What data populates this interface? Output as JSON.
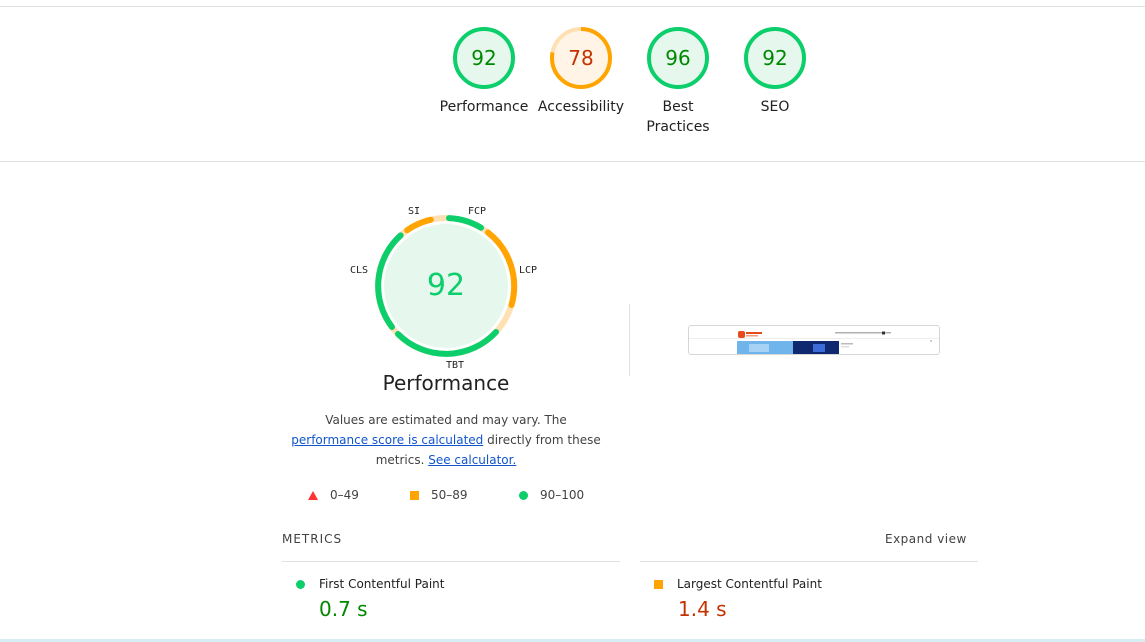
{
  "categories": [
    {
      "label": "Performance",
      "score": "92",
      "level": "pass"
    },
    {
      "label": "Accessibility",
      "score": "78",
      "level": "average"
    },
    {
      "label": "Best Practices",
      "score": "96",
      "level": "pass"
    },
    {
      "label": "SEO",
      "score": "92",
      "level": "pass"
    }
  ],
  "performance": {
    "score": "92",
    "title": "Performance",
    "metric_labels": {
      "si": "SI",
      "fcp": "FCP",
      "lcp": "LCP",
      "tbt": "TBT",
      "cls": "CLS"
    },
    "desc_prefix": "Values are estimated and may vary. The ",
    "desc_link1": "performance score is calculated",
    "desc_middle": " directly from these metrics. ",
    "desc_link2": "See calculator."
  },
  "legend": [
    {
      "range": "0–49",
      "shape": "triangle",
      "color": "#ff3333"
    },
    {
      "range": "50–89",
      "shape": "square",
      "color": "#ffa400"
    },
    {
      "range": "90–100",
      "shape": "circle",
      "color": "#0cce6b"
    }
  ],
  "metrics": {
    "header": "METRICS",
    "expand_label": "Expand view",
    "items": [
      {
        "name": "First Contentful Paint",
        "value": "0.7 s",
        "level": "pass"
      },
      {
        "name": "Largest Contentful Paint",
        "value": "1.4 s",
        "level": "average"
      }
    ]
  },
  "colors": {
    "pass": "#0cce6b",
    "pass_text": "#008800",
    "pass_fill": "#e6f8ed",
    "average": "#ffa400",
    "average_text": "#c33300",
    "average_fill": "#fff4e6",
    "link": "#1155cc"
  }
}
